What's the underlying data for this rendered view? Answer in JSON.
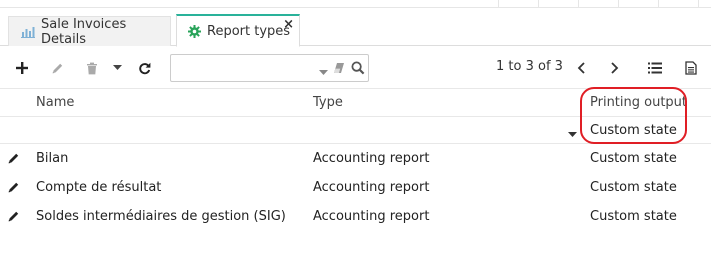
{
  "tabs": [
    {
      "label": "Sale Invoices Details",
      "icon": "bar-chart-icon",
      "active": false
    },
    {
      "label": "Report types",
      "icon": "gear-icon",
      "active": true,
      "close": "×"
    }
  ],
  "toolbar": {
    "filter_value": "",
    "pager_text": "1 to 3 of 3"
  },
  "columns": {
    "name": "Name",
    "type": "Type",
    "printing_output": "Printing output"
  },
  "filter_row": {
    "printing_output_value": "Custom state"
  },
  "rows": [
    {
      "name": "Bilan",
      "type": "Accounting report",
      "printing_output": "Custom state"
    },
    {
      "name": "Compte de résultat",
      "type": "Accounting report",
      "printing_output": "Custom state"
    },
    {
      "name": "Soldes intermédiaires de gestion (SIG)",
      "type": "Accounting report",
      "printing_output": "Custom state"
    }
  ],
  "colors": {
    "active_tab_accent": "#29b29a",
    "annotation_circle": "#e01e25"
  }
}
